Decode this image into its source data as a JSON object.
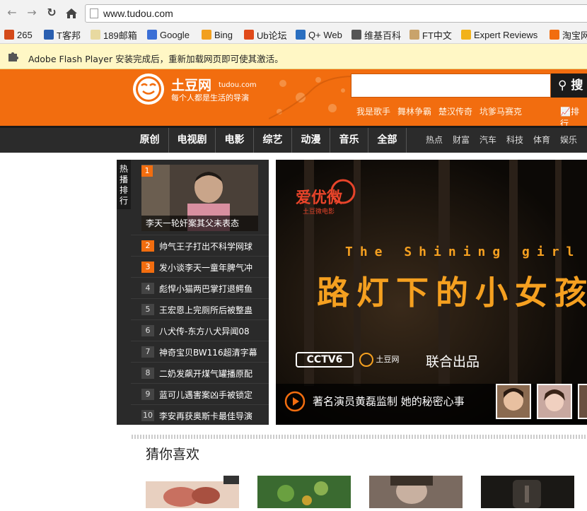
{
  "browser": {
    "url": "www.tudou.com",
    "bookmarks": [
      {
        "label": "265",
        "icon": "265-icon",
        "color": "#d44a1a"
      },
      {
        "label": "T客邦",
        "icon": "wrench-icon",
        "color": "#2a5fb0"
      },
      {
        "label": "189邮箱",
        "icon": "folder-icon",
        "color": "#e8d9a0"
      },
      {
        "label": "Google",
        "icon": "google-icon",
        "color": "#3b6fd6"
      },
      {
        "label": "Bing",
        "icon": "bing-icon",
        "color": "#f2a020"
      },
      {
        "label": "Ub论坛",
        "icon": "ubuntu-icon",
        "color": "#e04a1a"
      },
      {
        "label": "Q+ Web",
        "icon": "qplus-icon",
        "color": "#2a6fc0"
      },
      {
        "label": "维基百科",
        "icon": "wikipedia-icon",
        "color": "#555555"
      },
      {
        "label": "FT中文",
        "icon": "ft-icon",
        "color": "#c9a36b"
      },
      {
        "label": "Expert Reviews",
        "icon": "check-icon",
        "color": "#f2b21a"
      },
      {
        "label": "淘宝网",
        "icon": "taobao-icon",
        "color": "#f26d0f"
      }
    ]
  },
  "infobar": {
    "message": "Adobe Flash Player 安装完成后，重新加载网页即可使其激活。"
  },
  "site": {
    "logo_name": "土豆网",
    "logo_domain": "tudou.com",
    "logo_tagline": "每个人都是生活的导演",
    "search_button": "搜",
    "search_placeholder": "",
    "hot_tags": [
      "我是歌手",
      "舞林争霸",
      "楚汉传奇",
      "坑爹马赛克"
    ],
    "rank_link": "排行",
    "nav_main": [
      "原创",
      "电视剧",
      "电影",
      "综艺",
      "动漫",
      "音乐",
      "全部"
    ],
    "nav_sub": [
      "热点",
      "财富",
      "汽车",
      "科技",
      "体育",
      "娱乐"
    ]
  },
  "hot": {
    "label": "热播排行",
    "feature_caption": "李天一轮奸案其父未表态",
    "items": [
      {
        "num": "2",
        "title": "帅气王子打出不科学网球"
      },
      {
        "num": "3",
        "title": "发小谈李天一童年脾气冲"
      },
      {
        "num": "4",
        "title": "彪悍小猫两巴掌打退鳄鱼"
      },
      {
        "num": "5",
        "title": "王宏恩上完厕所后被整蛊"
      },
      {
        "num": "6",
        "title": "八犬传-东方八犬异闻08"
      },
      {
        "num": "7",
        "title": "神奇宝贝BW116超清字幕"
      },
      {
        "num": "8",
        "title": "二奶发飙开煤气罐播原配"
      },
      {
        "num": "9",
        "title": "蓝可儿遇害案凶手被锁定"
      },
      {
        "num": "10",
        "title": "李安再获奥斯卡最佳导演"
      }
    ]
  },
  "banner": {
    "brand": "爱优微",
    "brand_sub": "土豆微电影",
    "subtitle_en": "The Shining girl",
    "title_cn": "路灯下的小女孩",
    "partner_cctv": "CCTV6",
    "partner_tudou": "土豆网",
    "partner_text": "联合出品",
    "caption": "著名演员黄磊监制 她的秘密心事"
  },
  "recommend": {
    "title": "猜你喜欢"
  }
}
